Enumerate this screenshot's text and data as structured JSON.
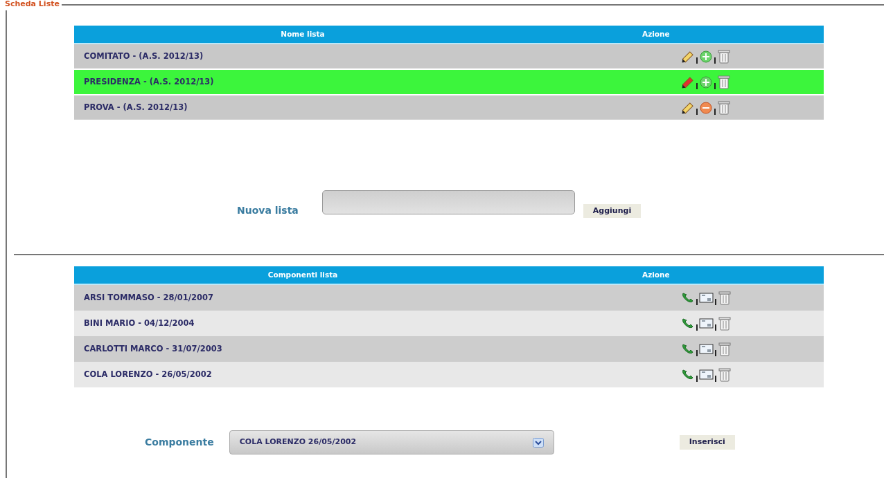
{
  "legend": "Scheda Liste",
  "lists": {
    "columns": [
      "Nome lista",
      "Azione"
    ],
    "rows": [
      {
        "name": "COMITATO - (A.S. 2012/13)",
        "selected": false,
        "enabled": true
      },
      {
        "name": "PRESIDENZA - (A.S. 2012/13)",
        "selected": true,
        "enabled": true
      },
      {
        "name": "PROVA - (A.S. 2012/13)",
        "selected": false,
        "enabled": false
      }
    ]
  },
  "new_list": {
    "label": "Nuova lista",
    "button": "Aggiungi"
  },
  "members": {
    "columns": [
      "Componenti lista",
      "Azione"
    ],
    "rows": [
      {
        "name": "ARSI TOMMASO - 28/01/2007"
      },
      {
        "name": "BINI MARIO - 04/12/2004"
      },
      {
        "name": "CARLOTTI MARCO - 31/07/2003"
      },
      {
        "name": "COLA LORENZO - 26/05/2002"
      }
    ]
  },
  "member_picker": {
    "label": "Componente",
    "value": "COLA LORENZO 26/05/2002",
    "button": "Inserisci"
  }
}
